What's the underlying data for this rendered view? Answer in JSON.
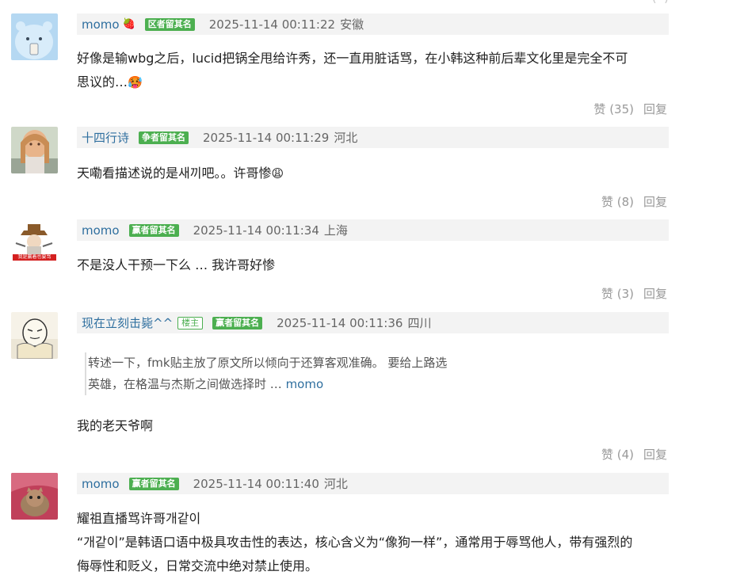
{
  "top_stub": "·· (··)",
  "comments": [
    {
      "username": "momo",
      "icon": "strawberry-icon",
      "badges": [
        "区者留其名"
      ],
      "timestamp": "2025-11-14 00:11:22",
      "location": "安徽",
      "content_line1": "好像是输wbg之后，lucid把锅全甩给许秀，还一直用脏话骂，在小韩这种前后辈文化里是完全不可",
      "content_line2": "思议的…",
      "likes": "赞 (35)",
      "reply": "回复"
    },
    {
      "username": "十四行诗",
      "badges": [
        "争者留其名"
      ],
      "timestamp": "2025-11-14 00:11:29",
      "location": "河北",
      "content_line1": "天嘞看描述说的是새끼吧。。许哥惨",
      "likes": "赞 (8)",
      "reply": "回复"
    },
    {
      "username": "momo",
      "badges": [
        "赢者留其名"
      ],
      "timestamp": "2025-11-14 00:11:34",
      "location": "上海",
      "content_line1": "不是没人干预一下么 … 我许哥好惨",
      "likes": "赞 (3)",
      "reply": "回复",
      "avatar_caption": "我是赢着也要骂"
    },
    {
      "username": "现在立刻击毙^^",
      "owner_badge": "楼主",
      "badges": [
        "赢者留其名"
      ],
      "timestamp": "2025-11-14 00:11:36",
      "location": "四川",
      "quote_line1": "转述一下，fmk贴主放了原文所以倾向于还算客观准确。 要给上路选",
      "quote_line2": "英雄，在格温与杰斯之间做选择时 …",
      "quote_author": "momo",
      "content_line1": "我的老天爷啊",
      "likes": "赞 (4)",
      "reply": "回复"
    },
    {
      "username": "momo",
      "badges": [
        "赢者留其名"
      ],
      "timestamp": "2025-11-14 00:11:40",
      "location": "河北",
      "content_line1": "耀祖直播骂许哥개같이",
      "content_line2": "“개같이”是韩语口语中极具攻击性的表达，核心含义为“像狗一样”，通常用于辱骂他人，带有强烈的",
      "content_line3": "侮辱性和贬义，日常交流中绝对禁止使用。"
    }
  ],
  "colors": {
    "username": "#2f6f9f",
    "badge_green": "#4caf50",
    "meta_bar_bg": "#f3f3f3",
    "action_gray": "#999999"
  }
}
